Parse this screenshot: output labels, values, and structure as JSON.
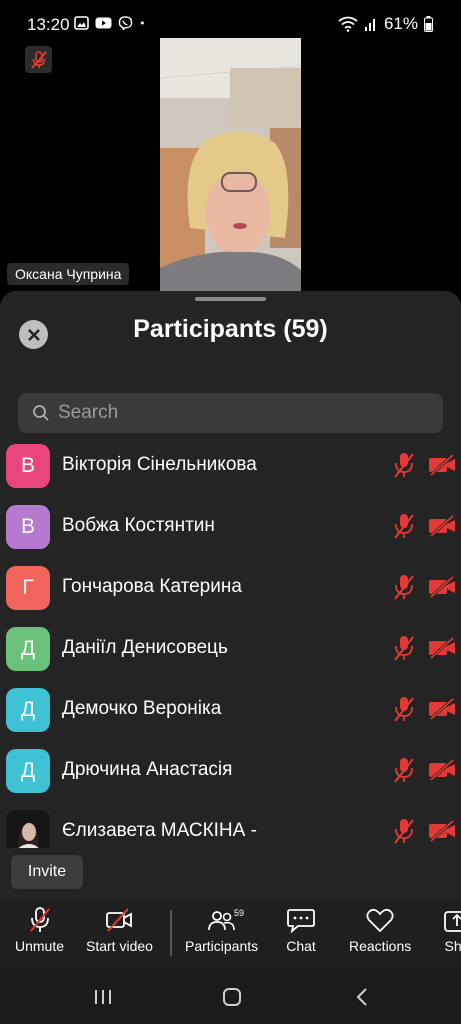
{
  "status_bar": {
    "time": "13:20",
    "battery": "61%",
    "left_icons": [
      "gallery-icon",
      "youtube-icon",
      "viber-icon",
      "dot-icon"
    ],
    "right_icons": [
      "wifi-icon",
      "signal-icon",
      "battery-icon"
    ]
  },
  "video": {
    "speaker_name": "Оксана Чуприна",
    "speaker_muted": true
  },
  "participants_panel": {
    "title": "Participants (59)",
    "search_placeholder": "Search",
    "participants": [
      {
        "initial": "В",
        "name": "Вікторія Сінельникова",
        "avatar_color": "#e8467c",
        "mic": "muted",
        "video": "off"
      },
      {
        "initial": "В",
        "name": "Вобжа Костянтин",
        "avatar_color": "#b57ad0",
        "mic": "muted",
        "video": "off"
      },
      {
        "initial": "Г",
        "name": "Гончарова Катерина",
        "avatar_color": "#f0645c",
        "mic": "muted",
        "video": "off"
      },
      {
        "initial": "Д",
        "name": "Даніїл Денисовець",
        "avatar_color": "#6bc07a",
        "mic": "muted",
        "video": "off"
      },
      {
        "initial": "Д",
        "name": "Демочко Вероніка",
        "avatar_color": "#3fc3d4",
        "mic": "muted",
        "video": "off"
      },
      {
        "initial": "Д",
        "name": "Дрючина Анастасія",
        "avatar_color": "#3fc3d4",
        "mic": "muted",
        "video": "off"
      },
      {
        "initial": "",
        "name": "Єлизавета МАСКІНА -",
        "avatar_color": "#1a1a1a",
        "mic": "muted",
        "video": "off"
      }
    ],
    "invite_label": "Invite"
  },
  "toolbar": {
    "unmute_label": "Unmute",
    "start_video_label": "Start video",
    "participants_label": "Participants",
    "participants_count": "59",
    "chat_label": "Chat",
    "reactions_label": "Reactions",
    "share_label": "Sha"
  },
  "colors": {
    "muted_red": "#e53935",
    "sheet_bg": "#242424"
  }
}
